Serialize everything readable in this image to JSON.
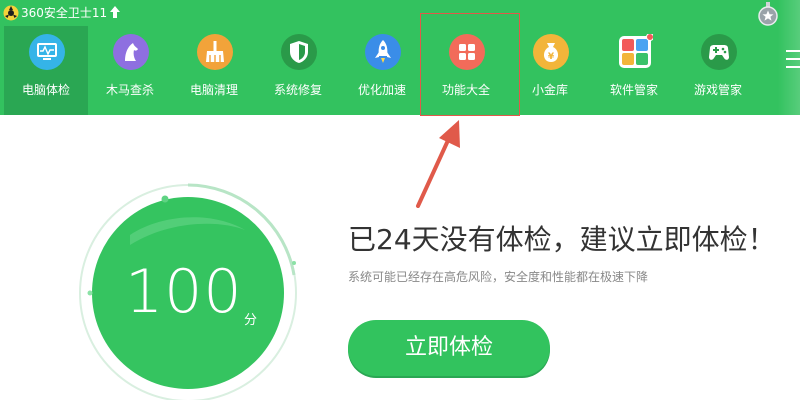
{
  "window": {
    "title": "360安全卫士11",
    "colors": {
      "brand_green": "#33c25f",
      "active_green": "#2aa753",
      "annotation_red": "#e05a4a"
    }
  },
  "nav": {
    "items": [
      {
        "label": "电脑体检",
        "icon": "monitor-icon",
        "color": "#2aa753"
      },
      {
        "label": "木马查杀",
        "icon": "horse-icon",
        "color": "#8e6fe0"
      },
      {
        "label": "电脑清理",
        "icon": "broom-icon",
        "color": "#f2a33a"
      },
      {
        "label": "系统修复",
        "icon": "shield-icon",
        "color": "#2ea24f"
      },
      {
        "label": "优化加速",
        "icon": "rocket-icon",
        "color": "#3a8de8"
      },
      {
        "label": "功能大全",
        "icon": "grid-icon",
        "color": "#f26b5a"
      },
      {
        "label": "小金库",
        "icon": "money-bag-icon",
        "color": "#f2b53a"
      },
      {
        "label": "软件管家",
        "icon": "apps-icon",
        "color": "#ffffff"
      },
      {
        "label": "游戏管家",
        "icon": "gamepad-icon",
        "color": "#2ea24f"
      }
    ]
  },
  "main": {
    "score": "100",
    "score_unit": "分",
    "headline": "已24天没有体检，建议立即体检！",
    "subline": "系统可能已经存在高危风险，安全度和性能都在极速下降",
    "check_button": "立即体检"
  }
}
